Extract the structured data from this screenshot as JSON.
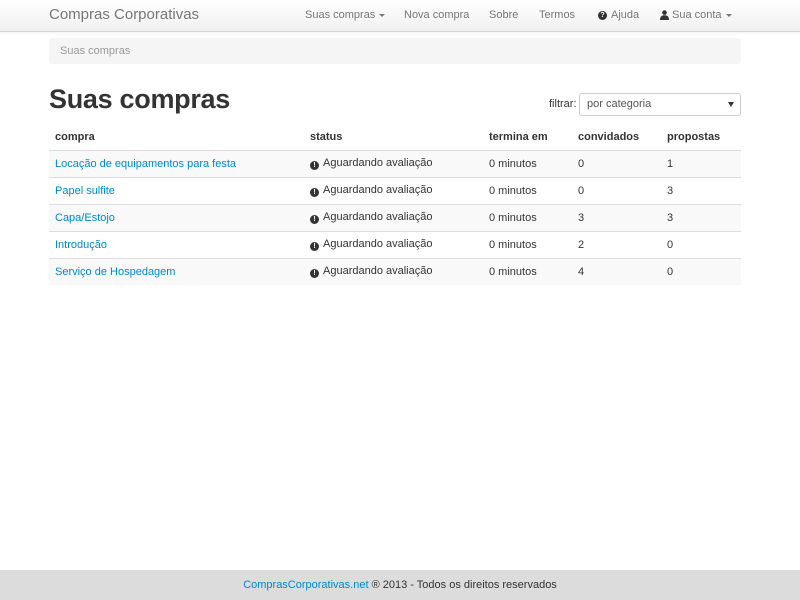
{
  "navbar": {
    "brand": "Compras Corporativas",
    "items": [
      {
        "label": "Suas compras",
        "dropdown": true
      },
      {
        "label": "Nova compra"
      },
      {
        "label": "Sobre"
      },
      {
        "label": "Termos"
      },
      {
        "label": "Ajuda",
        "icon": "question-circle-icon"
      },
      {
        "label": "Sua conta",
        "icon": "user-icon",
        "dropdown": true
      }
    ]
  },
  "breadcrumb": "Suas compras",
  "page_title": "Suas compras",
  "filter": {
    "label": "filtrar:",
    "selected": "por categoria"
  },
  "table": {
    "headers": [
      "compra",
      "status",
      "termina em",
      "convidados",
      "propostas"
    ],
    "rows": [
      {
        "compra": "Locação de equipamentos para festa",
        "status": "Aguardando avaliação",
        "termina": "0 minutos",
        "convidados": "0",
        "propostas": "1"
      },
      {
        "compra": "Papel sulfite",
        "status": "Aguardando avaliação",
        "termina": "0 minutos",
        "convidados": "0",
        "propostas": "3"
      },
      {
        "compra": "Capa/Estojo",
        "status": "Aguardando avaliação",
        "termina": "0 minutos",
        "convidados": "3",
        "propostas": "3"
      },
      {
        "compra": "Introdução",
        "status": "Aguardando avaliação",
        "termina": "0 minutos",
        "convidados": "2",
        "propostas": "0"
      },
      {
        "compra": "Serviço de Hospedagem",
        "status": "Aguardando avaliação",
        "termina": "0 minutos",
        "convidados": "4",
        "propostas": "0"
      }
    ]
  },
  "footer": {
    "link": "ComprasCorporativas.net",
    "text": " ® 2013 - Todos os direitos reservados"
  },
  "colors": {
    "link": "#0088cc",
    "footer_bg": "#dcdcdc",
    "navbar_bg": "#f5f5f5",
    "breadcrumb_bg": "#f5f5f5"
  }
}
